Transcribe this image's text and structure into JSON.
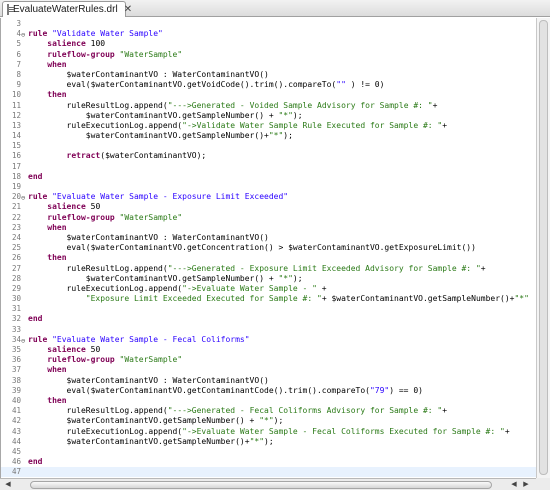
{
  "tab": {
    "label": "EvaluateWaterRules.drl",
    "close": "✕"
  },
  "scroll": {
    "left_arrow": "◀",
    "right_arrow": "▶"
  },
  "lines": [
    {
      "n": "3",
      "fold": "",
      "segs": []
    },
    {
      "n": "4",
      "fold": "⊖",
      "segs": [
        [
          "kw",
          "rule "
        ],
        [
          "str",
          "\"Validate Water Sample\""
        ]
      ]
    },
    {
      "n": "5",
      "fold": "",
      "segs": [
        [
          "",
          "    "
        ],
        [
          "kw",
          "salience "
        ],
        [
          "",
          "100"
        ]
      ]
    },
    {
      "n": "6",
      "fold": "",
      "segs": [
        [
          "",
          "    "
        ],
        [
          "kw",
          "ruleflow-group "
        ],
        [
          "strg",
          "\"WaterSample\""
        ]
      ]
    },
    {
      "n": "7",
      "fold": "",
      "segs": [
        [
          "",
          "    "
        ],
        [
          "kw",
          "when"
        ]
      ]
    },
    {
      "n": "8",
      "fold": "",
      "segs": [
        [
          "",
          "        $waterContaminantVO : WaterContaminantVO()"
        ]
      ]
    },
    {
      "n": "9",
      "fold": "",
      "segs": [
        [
          "",
          "        eval($waterContaminantVO.getVoidCode().trim().compareTo("
        ],
        [
          "str",
          "\"\""
        ],
        [
          "",
          " ) != 0)"
        ]
      ]
    },
    {
      "n": "10",
      "fold": "",
      "segs": [
        [
          "",
          "    "
        ],
        [
          "kw",
          "then"
        ]
      ]
    },
    {
      "n": "11",
      "fold": "",
      "segs": [
        [
          "",
          "        ruleResultLog.append("
        ],
        [
          "strg",
          "\"--->Generated - Voided Sample Advisory for Sample #: \""
        ],
        [
          "",
          "+"
        ]
      ]
    },
    {
      "n": "12",
      "fold": "",
      "segs": [
        [
          "",
          "            $waterContaminantVO.getSampleNumber() + "
        ],
        [
          "strg",
          "\"*\""
        ],
        [
          "",
          ");"
        ]
      ]
    },
    {
      "n": "13",
      "fold": "",
      "segs": [
        [
          "",
          "        ruleExecutionLog.append("
        ],
        [
          "strg",
          "\"->Validate Water Sample Rule Executed for Sample #: \""
        ],
        [
          "",
          "+"
        ]
      ]
    },
    {
      "n": "14",
      "fold": "",
      "segs": [
        [
          "",
          "            $waterContaminantVO.getSampleNumber()+"
        ],
        [
          "strg",
          "\"*\""
        ],
        [
          "",
          ");"
        ]
      ]
    },
    {
      "n": "15",
      "fold": "",
      "segs": []
    },
    {
      "n": "16",
      "fold": "",
      "segs": [
        [
          "",
          "        "
        ],
        [
          "kw",
          "retract"
        ],
        [
          "",
          "($waterContaminantVO);"
        ]
      ]
    },
    {
      "n": "17",
      "fold": "",
      "segs": []
    },
    {
      "n": "18",
      "fold": "",
      "segs": [
        [
          "kw",
          "end"
        ]
      ]
    },
    {
      "n": "19",
      "fold": "",
      "segs": []
    },
    {
      "n": "20",
      "fold": "⊖",
      "segs": [
        [
          "kw",
          "rule "
        ],
        [
          "str",
          "\"Evaluate Water Sample - Exposure Limit Exceeded\""
        ]
      ]
    },
    {
      "n": "21",
      "fold": "",
      "segs": [
        [
          "",
          "    "
        ],
        [
          "kw",
          "salience "
        ],
        [
          "",
          "50"
        ]
      ]
    },
    {
      "n": "22",
      "fold": "",
      "segs": [
        [
          "",
          "    "
        ],
        [
          "kw",
          "ruleflow-group "
        ],
        [
          "strg",
          "\"WaterSample\""
        ]
      ]
    },
    {
      "n": "23",
      "fold": "",
      "segs": [
        [
          "",
          "    "
        ],
        [
          "kw",
          "when"
        ]
      ]
    },
    {
      "n": "24",
      "fold": "",
      "segs": [
        [
          "",
          "        $waterContaminantVO : WaterContaminantVO()"
        ]
      ]
    },
    {
      "n": "25",
      "fold": "",
      "segs": [
        [
          "",
          "        eval($waterContaminantVO.getConcentration() > $waterContaminantVO.getExposureLimit())"
        ]
      ]
    },
    {
      "n": "26",
      "fold": "",
      "segs": [
        [
          "",
          "    "
        ],
        [
          "kw",
          "then"
        ]
      ]
    },
    {
      "n": "27",
      "fold": "",
      "segs": [
        [
          "",
          "        ruleResultLog.append("
        ],
        [
          "strg",
          "\"--->Generated - Exposure Limit Exceeded Advisory for Sample #: \""
        ],
        [
          "",
          "+"
        ]
      ]
    },
    {
      "n": "28",
      "fold": "",
      "segs": [
        [
          "",
          "            $waterContaminantVO.getSampleNumber() + "
        ],
        [
          "strg",
          "\"*\""
        ],
        [
          "",
          ");"
        ]
      ]
    },
    {
      "n": "29",
      "fold": "",
      "segs": [
        [
          "",
          "        ruleExecutionLog.append("
        ],
        [
          "strg",
          "\"->Evaluate Water Sample - \""
        ],
        [
          "",
          " +"
        ]
      ]
    },
    {
      "n": "30",
      "fold": "",
      "segs": [
        [
          "",
          "            "
        ],
        [
          "strg",
          "\"Exposure Limit Exceeded Executed for Sample #: \""
        ],
        [
          "",
          "+ $waterContaminantVO.getSampleNumber()+"
        ],
        [
          "strg",
          "\"*\""
        ]
      ]
    },
    {
      "n": "31",
      "fold": "",
      "segs": []
    },
    {
      "n": "32",
      "fold": "",
      "segs": [
        [
          "kw",
          "end"
        ]
      ]
    },
    {
      "n": "33",
      "fold": "",
      "segs": []
    },
    {
      "n": "34",
      "fold": "⊖",
      "segs": [
        [
          "kw",
          "rule "
        ],
        [
          "str",
          "\"Evaluate Water Sample - Fecal Coliforms\""
        ]
      ]
    },
    {
      "n": "35",
      "fold": "",
      "segs": [
        [
          "",
          "    "
        ],
        [
          "kw",
          "salience "
        ],
        [
          "",
          "50"
        ]
      ]
    },
    {
      "n": "36",
      "fold": "",
      "segs": [
        [
          "",
          "    "
        ],
        [
          "kw",
          "ruleflow-group "
        ],
        [
          "strg",
          "\"WaterSample\""
        ]
      ]
    },
    {
      "n": "37",
      "fold": "",
      "segs": [
        [
          "",
          "    "
        ],
        [
          "kw",
          "when"
        ]
      ]
    },
    {
      "n": "38",
      "fold": "",
      "segs": [
        [
          "",
          "        $waterContaminantVO : WaterContaminantVO()"
        ]
      ]
    },
    {
      "n": "39",
      "fold": "",
      "segs": [
        [
          "",
          "        eval($waterContaminantVO.getContaminantCode().trim().compareTo("
        ],
        [
          "str",
          "\"79\""
        ],
        [
          "",
          ") == 0)"
        ]
      ]
    },
    {
      "n": "40",
      "fold": "",
      "segs": [
        [
          "",
          "    "
        ],
        [
          "kw",
          "then"
        ]
      ]
    },
    {
      "n": "41",
      "fold": "",
      "segs": [
        [
          "",
          "        ruleResultLog.append("
        ],
        [
          "strg",
          "\"--->Generated - Fecal Coliforms Advisory for Sample #: \""
        ],
        [
          "",
          "+"
        ]
      ]
    },
    {
      "n": "42",
      "fold": "",
      "segs": [
        [
          "",
          "        $waterContaminantVO.getSampleNumber() + "
        ],
        [
          "strg",
          "\"*\""
        ],
        [
          "",
          ");"
        ]
      ]
    },
    {
      "n": "43",
      "fold": "",
      "segs": [
        [
          "",
          "        ruleExecutionLog.append("
        ],
        [
          "strg",
          "\"->Evaluate Water Sample - Fecal Coliforms Executed for Sample #: \""
        ],
        [
          "",
          "+"
        ]
      ]
    },
    {
      "n": "44",
      "fold": "",
      "segs": [
        [
          "",
          "        $waterContaminantVO.getSampleNumber()+"
        ],
        [
          "strg",
          "\"*\""
        ],
        [
          "",
          ");"
        ]
      ]
    },
    {
      "n": "45",
      "fold": "",
      "segs": []
    },
    {
      "n": "46",
      "fold": "",
      "segs": [
        [
          "kw",
          "end"
        ]
      ]
    },
    {
      "n": "47",
      "fold": "",
      "segs": [],
      "current": true
    }
  ]
}
